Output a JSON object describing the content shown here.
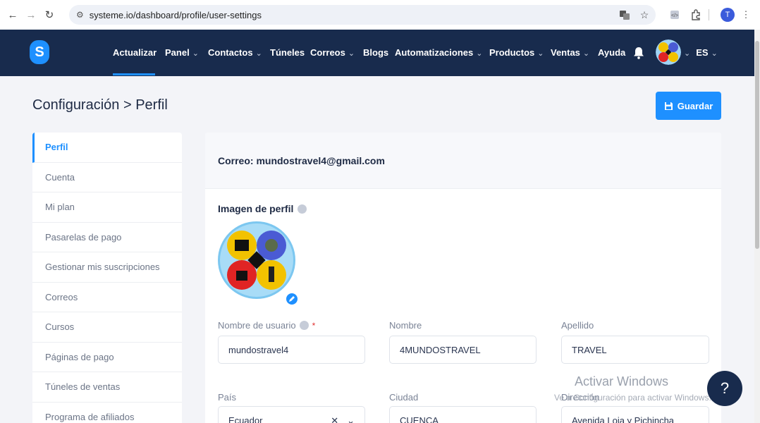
{
  "browser": {
    "url": "systeme.io/dashboard/profile/user-settings",
    "profile_initial": "T"
  },
  "nav": {
    "items": [
      {
        "label": "Actualizar",
        "dropdown": false
      },
      {
        "label": "Panel",
        "dropdown": true
      },
      {
        "label": "Contactos",
        "dropdown": true
      },
      {
        "label": "Túneles",
        "dropdown": false
      },
      {
        "label": "Correos",
        "dropdown": true
      },
      {
        "label": "Blogs",
        "dropdown": false
      },
      {
        "label": "Automatizaciones",
        "dropdown": true
      },
      {
        "label": "Productos",
        "dropdown": true
      },
      {
        "label": "Ventas",
        "dropdown": true
      },
      {
        "label": "Ayuda",
        "dropdown": false
      }
    ],
    "language": "ES",
    "logo_letter": "S"
  },
  "header": {
    "title": "Configuración > Perfil",
    "save_label": "Guardar"
  },
  "sidebar": {
    "items": [
      {
        "label": "Perfil",
        "active": true
      },
      {
        "label": "Cuenta",
        "active": false
      },
      {
        "label": "Mi plan",
        "active": false
      },
      {
        "label": "Pasarelas de pago",
        "active": false
      },
      {
        "label": "Gestionar mis suscripciones",
        "active": false
      },
      {
        "label": "Correos",
        "active": false
      },
      {
        "label": "Cursos",
        "active": false
      },
      {
        "label": "Páginas de pago",
        "active": false
      },
      {
        "label": "Túneles de ventas",
        "active": false
      },
      {
        "label": "Programa de afiliados",
        "active": false
      }
    ]
  },
  "profile": {
    "email_line": "Correo: mundostravel4@gmail.com",
    "image_title": "Imagen de perfil",
    "fields": {
      "username": {
        "label": "Nombre de usuario",
        "required": "*",
        "value": "mundostravel4"
      },
      "first_name": {
        "label": "Nombre",
        "value": "4MUNDOSTRAVEL"
      },
      "last_name": {
        "label": "Apellido",
        "value": "TRAVEL"
      },
      "country": {
        "label": "País",
        "value": "Ecuador"
      },
      "city": {
        "label": "Ciudad",
        "value": "CUENCA"
      },
      "address": {
        "label": "Dirección",
        "value": "Avenida Loja y Pichincha"
      }
    }
  },
  "overlay": {
    "watermark_title": "Activar Windows",
    "watermark_sub": "Ve a Configuración para activar Windows.",
    "help_label": "?"
  },
  "colors": {
    "nav_bg": "#182b4d",
    "accent": "#1e90ff"
  }
}
